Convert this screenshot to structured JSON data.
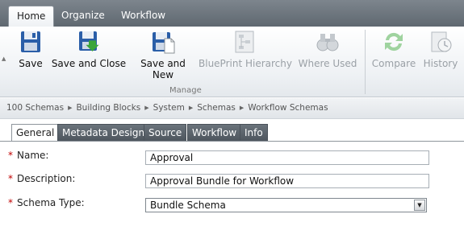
{
  "ribbon_tabs": [
    {
      "label": "Home",
      "active": true
    },
    {
      "label": "Organize",
      "active": false
    },
    {
      "label": "Workflow",
      "active": false
    }
  ],
  "ribbon": {
    "buttons": [
      {
        "label": "Save",
        "icon": "save-icon",
        "enabled": true
      },
      {
        "label": "Save and Close",
        "icon": "save-and-close-icon",
        "enabled": true
      },
      {
        "label": "Save and New",
        "icon": "save-and-new-icon",
        "enabled": true
      },
      {
        "label": "BluePrint Hierarchy",
        "icon": "blueprint-hierarchy-icon",
        "enabled": false
      },
      {
        "label": "Where Used",
        "icon": "binoculars-icon",
        "enabled": false
      },
      {
        "label": "Compare",
        "icon": "compare-icon",
        "enabled": false
      },
      {
        "label": "History",
        "icon": "history-icon",
        "enabled": false
      }
    ],
    "group_label": "Manage"
  },
  "breadcrumb": [
    "100 Schemas",
    "Building Blocks",
    "System",
    "Schemas",
    "Workflow Schemas"
  ],
  "form_tabs": [
    {
      "label": "General",
      "active": true
    },
    {
      "label": "Metadata Design",
      "active": false
    },
    {
      "label": "Source",
      "active": false
    },
    {
      "label": "Workflow",
      "active": false
    },
    {
      "label": "Info",
      "active": false
    }
  ],
  "form": {
    "required_marker": "*",
    "name_label": "Name:",
    "name_value": "Approval",
    "description_label": "Description:",
    "description_value": "Approval Bundle for Workflow",
    "schema_type_label": "Schema Type:",
    "schema_type_value": "Bundle Schema"
  },
  "colors": {
    "tabbar": "#6b737b",
    "required": "#c00000",
    "form_tab": "#5a626a"
  }
}
